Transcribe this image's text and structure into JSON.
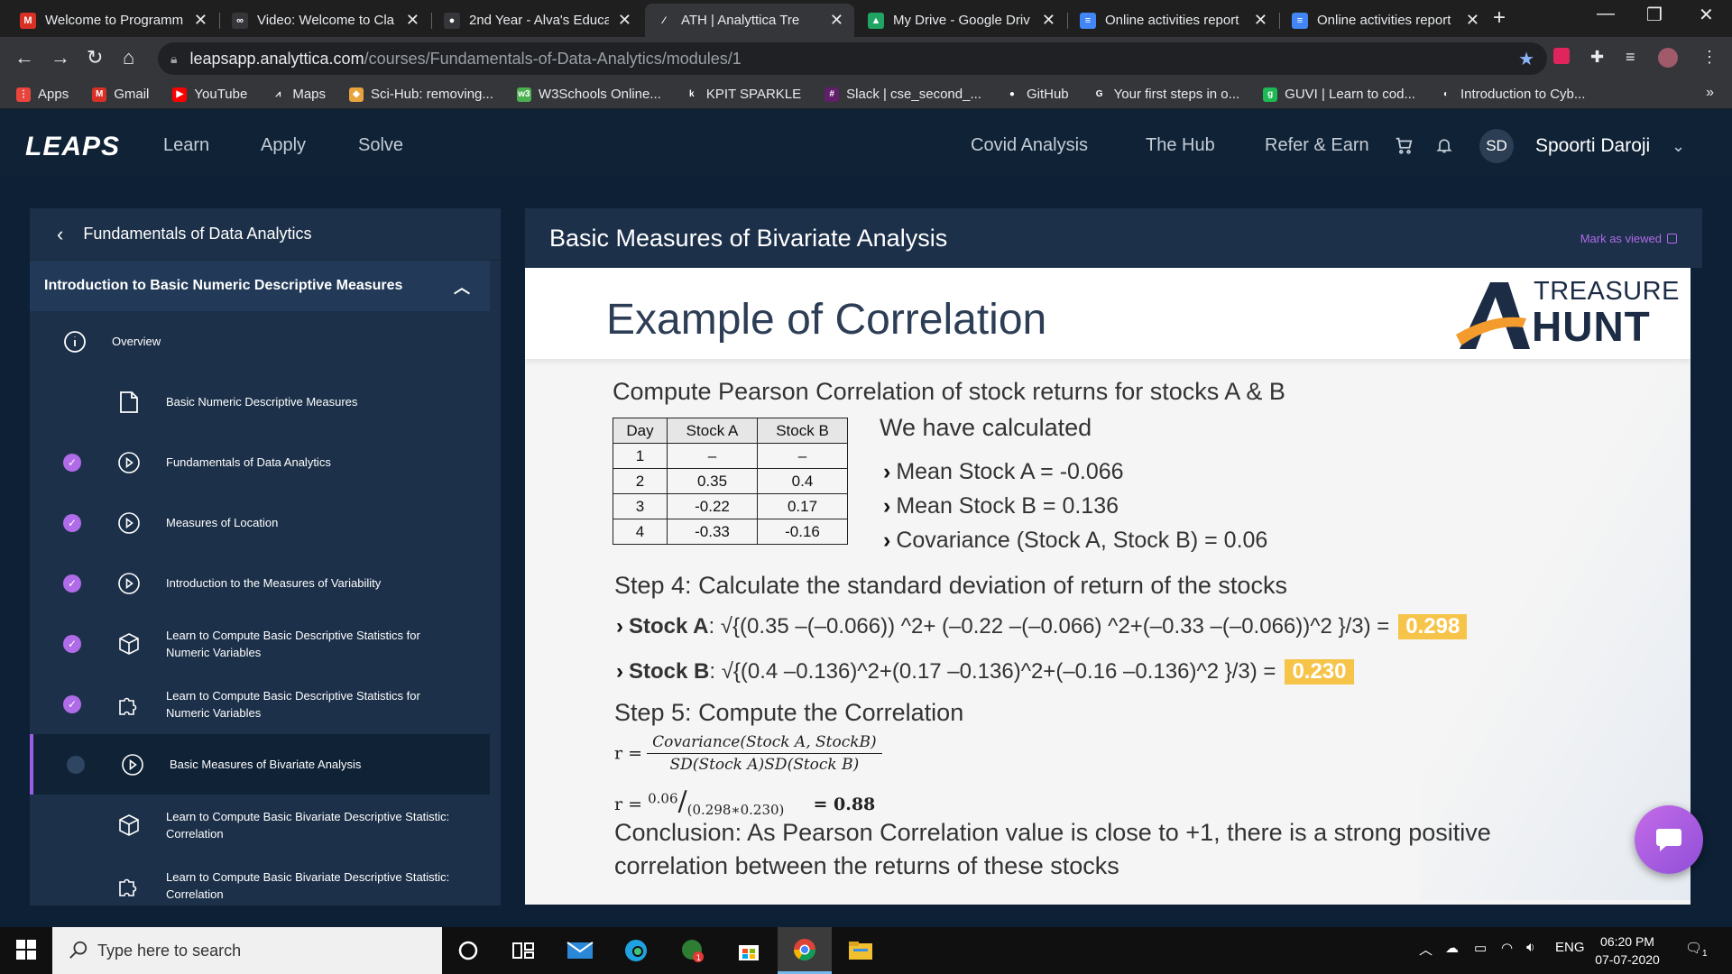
{
  "browser": {
    "tabs": [
      {
        "title": "Welcome to Programm",
        "icon": "gmail-icon",
        "color": "#d93025",
        "glyph": "M"
      },
      {
        "title": "Video: Welcome to Cla",
        "icon": "coursera-icon",
        "color": "#35363a",
        "glyph": "∞"
      },
      {
        "title": "2nd Year - Alva's Educa",
        "icon": "github-icon",
        "color": "#35363a",
        "glyph": "●"
      },
      {
        "title": "ATH | Analyttica Tre",
        "icon": "analyttica-icon",
        "color": "#35363a",
        "glyph": "⁄",
        "active": true
      },
      {
        "title": "My Drive - Google Driv",
        "icon": "google-drive-icon",
        "color": "#1fa463",
        "glyph": "▲"
      },
      {
        "title": "Online activities report",
        "icon": "google-docs-icon",
        "color": "#4285f4",
        "glyph": "≡"
      },
      {
        "title": "Online activities report",
        "icon": "google-docs-icon",
        "color": "#4285f4",
        "glyph": "≡"
      }
    ],
    "url_host": "leapsapp.analyttica.com",
    "url_path": "/courses/Fundamentals-of-Data-Analytics/modules/1",
    "bookmarks": [
      {
        "label": "Apps",
        "icon": "apps-grid-icon",
        "color": "#e8453c",
        "glyph": "⋮"
      },
      {
        "label": "Gmail",
        "icon": "gmail-icon",
        "color": "#d93025",
        "glyph": "M"
      },
      {
        "label": "YouTube",
        "icon": "youtube-icon",
        "color": "#ff0000",
        "glyph": "▶"
      },
      {
        "label": "Maps",
        "icon": "maps-icon",
        "color": "#35363a",
        "glyph": "⩘"
      },
      {
        "label": "Sci-Hub: removing...",
        "icon": "scihub-icon",
        "color": "#e8a33c",
        "glyph": "◆"
      },
      {
        "label": "W3Schools Online...",
        "icon": "w3schools-icon",
        "color": "#4caf50",
        "glyph": "w3"
      },
      {
        "label": "KPIT SPARKLE",
        "icon": "kpit-icon",
        "color": "#35363a",
        "glyph": "k"
      },
      {
        "label": "Slack | cse_second_...",
        "icon": "slack-icon",
        "color": "#611f69",
        "glyph": "#"
      },
      {
        "label": "GitHub",
        "icon": "github-icon",
        "color": "#35363a",
        "glyph": "●"
      },
      {
        "label": "Your first steps in o...",
        "icon": "google-icon",
        "color": "#35363a",
        "glyph": "G"
      },
      {
        "label": "GUVI | Learn to cod...",
        "icon": "guvi-icon",
        "color": "#1db954",
        "glyph": "g"
      },
      {
        "label": "Introduction to Cyb...",
        "icon": "cyber-icon",
        "color": "#35363a",
        "glyph": "◐"
      }
    ]
  },
  "app": {
    "logo": "LEAPS",
    "nav": [
      "Learn",
      "Apply",
      "Solve"
    ],
    "right_links": [
      "Covid Analysis",
      "The Hub",
      "Refer & Earn"
    ],
    "avatar_initials": "SD",
    "user_name": "Spoorti Daroji"
  },
  "sidebar": {
    "course_title": "Fundamentals of Data Analytics",
    "module_title": "Introduction to Basic Numeric Descriptive Measures",
    "items": [
      {
        "label": "Overview",
        "icon": "info-icon",
        "status": "none"
      },
      {
        "label": "Basic Numeric Descriptive Measures",
        "icon": "document-icon",
        "status": "none"
      },
      {
        "label": "Fundamentals of Data Analytics",
        "icon": "play-icon",
        "status": "done"
      },
      {
        "label": "Measures of Location",
        "icon": "play-icon",
        "status": "done"
      },
      {
        "label": "Introduction to the Measures of Variability",
        "icon": "play-icon",
        "status": "done"
      },
      {
        "label": "Learn to Compute Basic Descriptive Statistics for Numeric Variables",
        "icon": "cube-icon",
        "status": "done"
      },
      {
        "label": "Learn to Compute Basic Descriptive Statistics for Numeric Variables",
        "icon": "puzzle-icon",
        "status": "done"
      },
      {
        "label": "Basic Measures of Bivariate Analysis",
        "icon": "play-icon",
        "status": "current"
      },
      {
        "label": "Learn to Compute Basic Bivariate Descriptive Statistic: Correlation",
        "icon": "cube-icon",
        "status": "none"
      },
      {
        "label": "Learn to Compute Basic Bivariate Descriptive Statistic: Correlation",
        "icon": "puzzle-icon",
        "status": "none"
      }
    ]
  },
  "main": {
    "title": "Basic Measures of Bivariate Analysis",
    "mark_viewed": "Mark as viewed"
  },
  "slide": {
    "heading": "Example of Correlation",
    "brand_line1": "TREASURE",
    "brand_line2": "HUNT",
    "problem": "Compute Pearson Correlation of stock returns for stocks A & B",
    "table": {
      "headers": [
        "Day",
        "Stock A",
        "Stock B"
      ],
      "rows": [
        [
          "1",
          "–",
          "–"
        ],
        [
          "2",
          "0.35",
          "0.4"
        ],
        [
          "3",
          "-0.22",
          "0.17"
        ],
        [
          "4",
          "-0.33",
          "-0.16"
        ]
      ]
    },
    "calculated_heading": "We have calculated",
    "calculated": [
      "Mean Stock A = -0.066",
      "Mean Stock B = 0.136",
      "Covariance (Stock A, Stock B) = 0.06"
    ],
    "step4": "Step 4: Calculate the standard deviation of return of the stocks",
    "sd_a_label": "Stock A",
    "sd_a_expr": ": √{(0.35 –(–0.066)) ^2+ (–0.22 –(–0.066) ^2+(–0.33 –(–0.066))^2 }/3) =",
    "sd_a_value": "0.298",
    "sd_b_label": "Stock B",
    "sd_b_expr": ": √{(0.4 –0.136)^2+(0.17 –0.136)^2+(–0.16 –0.136)^2 }/3)  =",
    "sd_b_value": "0.230",
    "step5": "Step 5: Compute the Correlation",
    "r_symbol": "r =",
    "r_num": "Covariance(Stock A, StockB)",
    "r_den": "SD(Stock A)SD(Stock B)",
    "r2_num": "0.06",
    "r2_den": "(0.298∗0.230)",
    "r2_result": "= 0.88",
    "conclusion_1": "Conclusion: As Pearson Correlation value is close to +1, there is a strong positive",
    "conclusion_2": "correlation between the returns of these stocks"
  },
  "taskbar": {
    "search_placeholder": "Type here to search",
    "lang": "ENG",
    "time": "06:20 PM",
    "date": "07-07-2020",
    "notifications": "1"
  },
  "colors": {
    "accent": "#b06be8",
    "highlight": "#f7c44a",
    "sidebar": "#1c3049"
  }
}
